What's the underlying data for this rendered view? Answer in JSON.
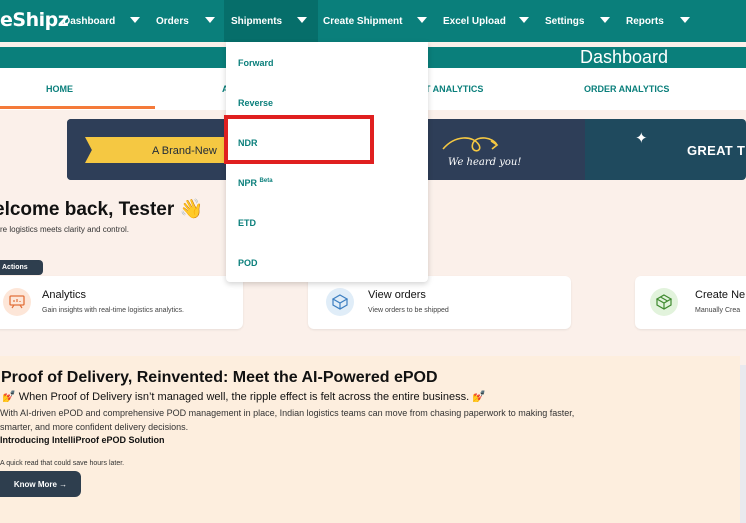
{
  "nav": {
    "logo": "eShipz",
    "items": [
      {
        "label": "Dashboard"
      },
      {
        "label": "Orders"
      },
      {
        "label": "Shipments"
      },
      {
        "label": "Create Shipment"
      },
      {
        "label": "Excel Upload"
      },
      {
        "label": "Settings"
      },
      {
        "label": "Reports"
      }
    ],
    "active_item": "Shipments"
  },
  "page_title": "Dashboard",
  "tabs": [
    "HOME",
    "A",
    "T ANALYTICS",
    "ORDER ANALYTICS"
  ],
  "active_tab": "HOME",
  "banner": {
    "ribbon_text": "A Brand-New",
    "heard_text": "We heard you!",
    "right_text": "GREAT T"
  },
  "welcome": {
    "title": "elcome back, Tester 👋",
    "subtitle": "re logistics meets clarity and control."
  },
  "actions": {
    "badge": "Actions",
    "cards": [
      {
        "title": "Analytics",
        "subtitle": "Gain insights with real-time logistics analytics.",
        "icon": "chart-board-icon"
      },
      {
        "title": "View orders",
        "subtitle": "View orders to be shipped",
        "icon": "box-icon"
      },
      {
        "title": "Create Ne",
        "subtitle": "Manually Crea",
        "icon": "package-icon"
      }
    ]
  },
  "epod": {
    "title": "Proof of Delivery, Reinvented: Meet the AI-Powered ePOD",
    "line2": "💅 When Proof of Delivery isn’t managed well, the ripple effect is felt across the entire business. 💅",
    "body": "With AI-driven ePOD and comprehensive POD management in place, Indian logistics teams can move from chasing paperwork to making faster, smarter, and more confident delivery decisions.",
    "intro": "Introducing IntelliProof ePOD Solution",
    "quick": "A quick read that could save hours later.",
    "button": "Know More →"
  },
  "dropdown": {
    "items": [
      {
        "label": "Forward"
      },
      {
        "label": "Reverse"
      },
      {
        "label": "NDR"
      },
      {
        "label": "NPR",
        "badge": "Beta"
      },
      {
        "label": "ETD"
      },
      {
        "label": "POD"
      }
    ],
    "highlighted": "NDR"
  },
  "colors": {
    "brand": "#0a7f7b",
    "accent": "#f47a3a",
    "highlight": "#e02020",
    "dark_button": "#2e3e4e"
  }
}
